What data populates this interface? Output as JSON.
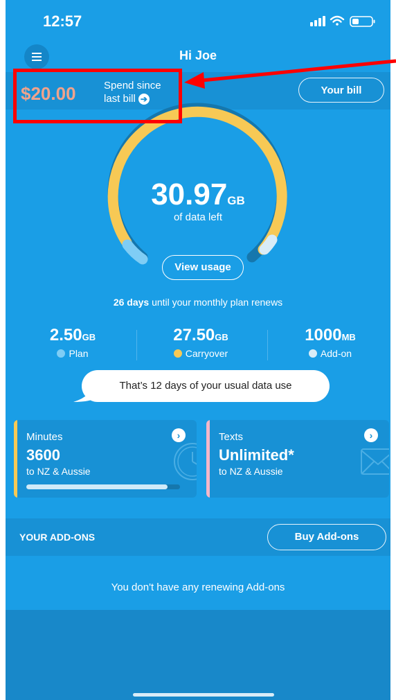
{
  "status_bar": {
    "time": "12:57"
  },
  "header": {
    "title": "Hi Joe"
  },
  "bill": {
    "amount": "$20.00",
    "spend_line1": "Spend since",
    "spend_line2": "last bill",
    "your_bill_label": "Your bill"
  },
  "data_gauge": {
    "value": "30.97",
    "unit": "GB",
    "caption": "of data left",
    "view_usage_label": "View usage"
  },
  "renewal": {
    "days": "26 days",
    "text": " until your monthly plan renews"
  },
  "breakdown": [
    {
      "value": "2.50",
      "unit": "GB",
      "label": "Plan",
      "color": "#7fcdf5"
    },
    {
      "value": "27.50",
      "unit": "GB",
      "label": "Carryover",
      "color": "#f7c955"
    },
    {
      "value": "1000",
      "unit": "MB",
      "label": "Add-on",
      "color": "#d9ecf7"
    }
  ],
  "tip": "That’s 12 days of your usual data use",
  "cards": {
    "minutes": {
      "label": "Minutes",
      "value": "3600",
      "sub": "to NZ & Aussie",
      "accent": "#f7c955",
      "progress": 0.92
    },
    "texts": {
      "label": "Texts",
      "value": "Unlimited*",
      "sub": "to NZ & Aussie",
      "accent": "#f4b7c9"
    }
  },
  "addons": {
    "heading": "YOUR ADD-ONS",
    "buy_label": "Buy Add-ons",
    "empty_text": "You don't have any renewing Add-ons"
  },
  "colors": {
    "background": "#1a9ee6",
    "highlight": "#ff0000",
    "amount": "#f0a38c"
  }
}
